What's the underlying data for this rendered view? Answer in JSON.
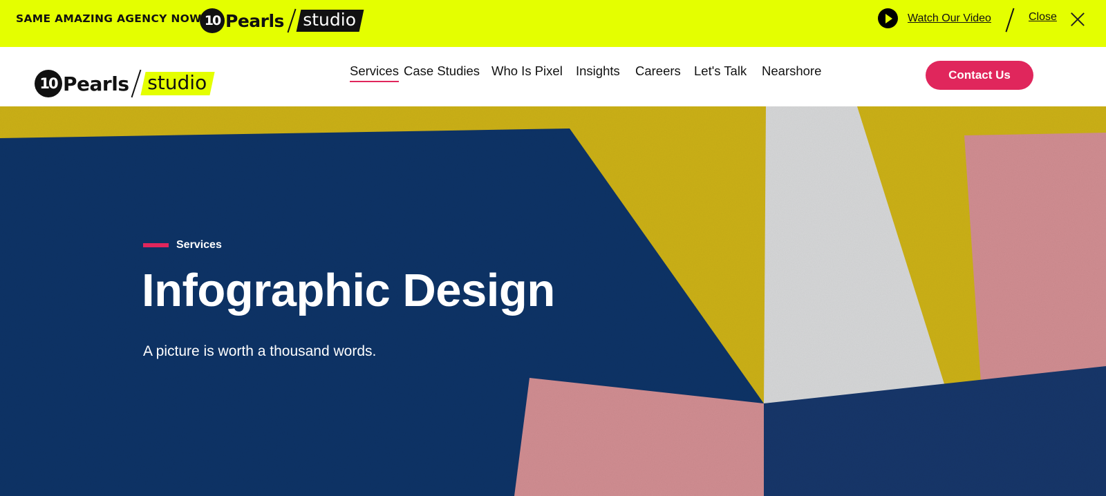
{
  "announcement": {
    "text": "SAME AMAZING AGENCY NOW",
    "logo_number": "10",
    "logo_word": "Pearls",
    "logo_studio": "studio",
    "watch_label": "Watch Our Video",
    "close_label": "Close"
  },
  "header": {
    "logo_number": "10",
    "logo_word": "Pearls",
    "logo_studio": "studio",
    "nav": [
      "Services",
      "Case Studies",
      "Who Is Pixel",
      "Insights",
      "Careers",
      "Let's Talk",
      "Nearshore"
    ],
    "active_nav": "Services",
    "cta_label": "Contact Us"
  },
  "hero": {
    "eyebrow": "Services",
    "title": "Infographic Design",
    "subtitle": "A picture is worth a thousand words."
  },
  "colors": {
    "accent_yellow": "#e4ff00",
    "accent_pink": "#e0265c",
    "navy": "#13356b",
    "mustard": "#e6c410",
    "salmon": "#ec9c9c"
  }
}
